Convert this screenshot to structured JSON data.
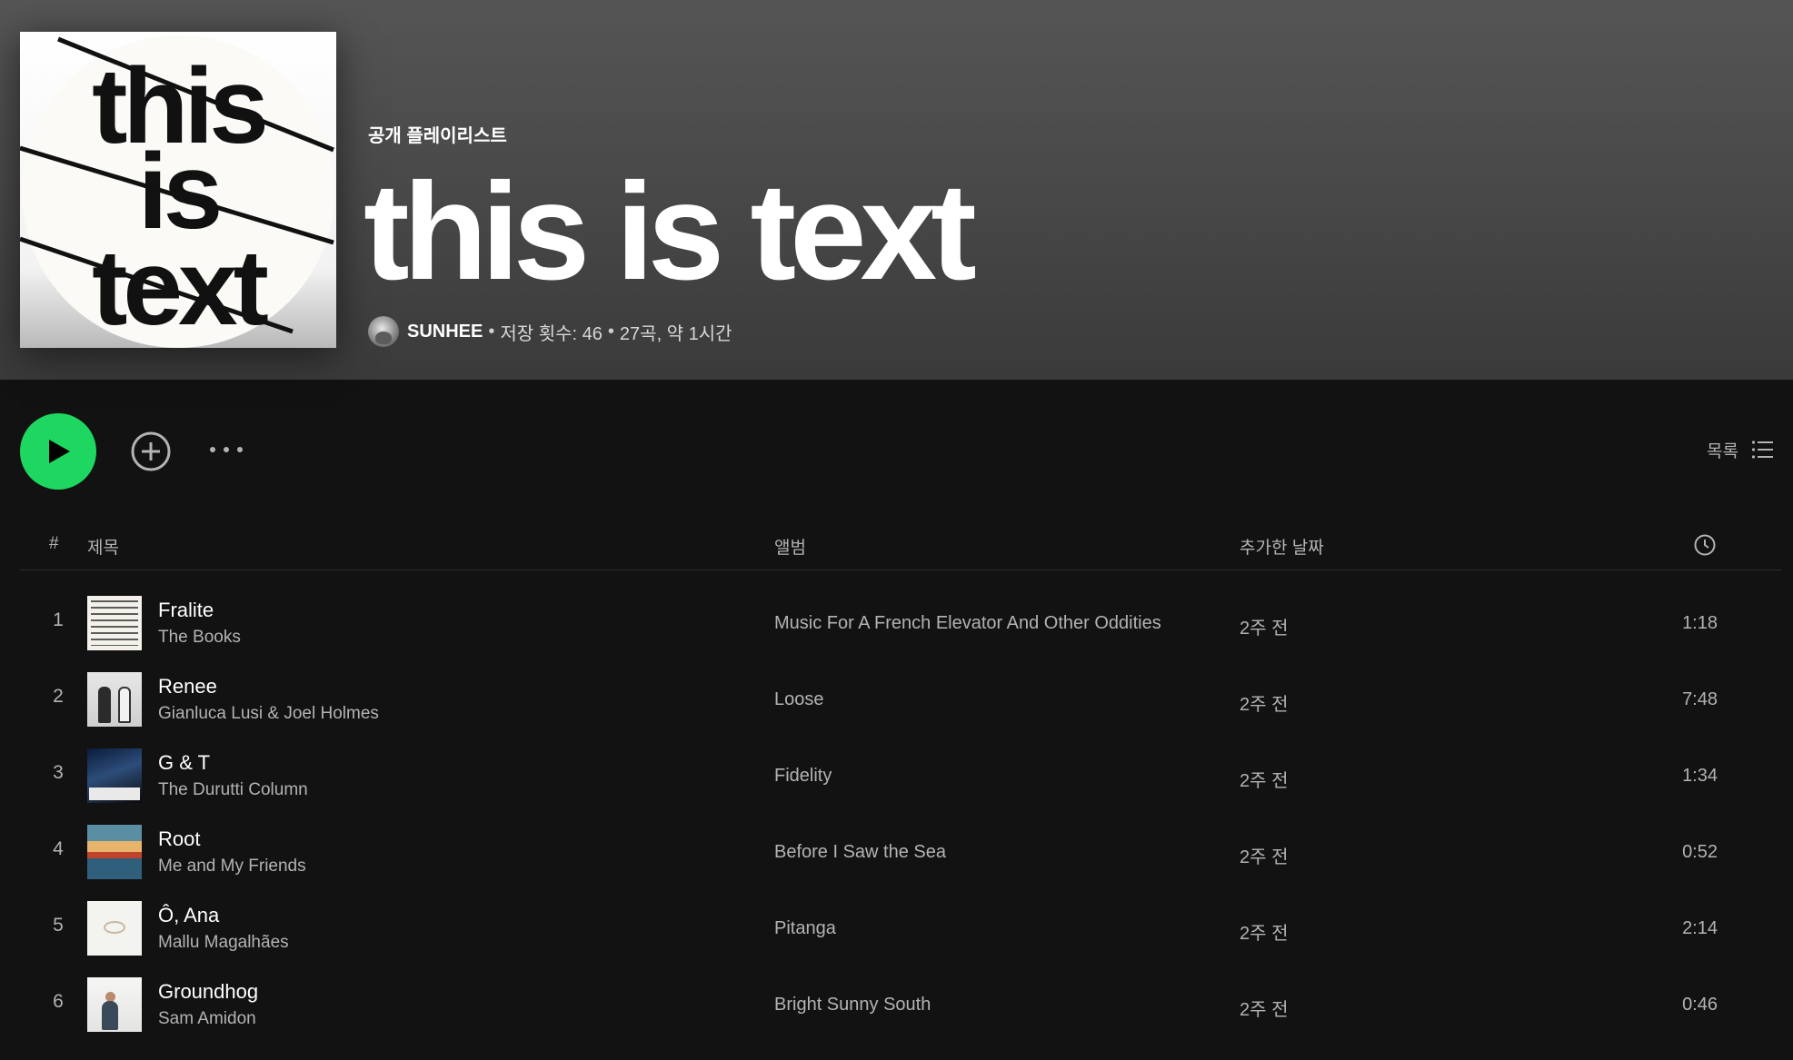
{
  "playlist": {
    "type_label": "공개 플레이리스트",
    "title": "this is text",
    "cover_text": [
      "this",
      "is",
      "text"
    ],
    "owner": "SUNHEE",
    "saves": "저장 횟수: 46",
    "summary": "27곡, 약 1시간"
  },
  "actions": {
    "play": "play",
    "add": "add",
    "more": "more",
    "view_label": "목록"
  },
  "columns": {
    "number": "#",
    "title": "제목",
    "album": "앨범",
    "date_added": "추가한 날짜",
    "duration_icon": "clock-icon"
  },
  "tracks": [
    {
      "num": "1",
      "title": "Fralite",
      "artist": "The Books",
      "album": "Music For A French Elevator And Other Oddities",
      "added": "2주 전",
      "duration": "1:18"
    },
    {
      "num": "2",
      "title": "Renee",
      "artist": "Gianluca Lusi & Joel Holmes",
      "album": "Loose",
      "added": "2주 전",
      "duration": "7:48"
    },
    {
      "num": "3",
      "title": "G & T",
      "artist": "The Durutti Column",
      "album": "Fidelity",
      "added": "2주 전",
      "duration": "1:34"
    },
    {
      "num": "4",
      "title": "Root",
      "artist": "Me and My Friends",
      "album": "Before I Saw the Sea",
      "added": "2주 전",
      "duration": "0:52"
    },
    {
      "num": "5",
      "title": "Ô, Ana",
      "artist": "Mallu Magalhães",
      "album": "Pitanga",
      "added": "2주 전",
      "duration": "2:14"
    },
    {
      "num": "6",
      "title": "Groundhog",
      "artist": "Sam Amidon",
      "album": "Bright Sunny South",
      "added": "2주 전",
      "duration": "0:46"
    }
  ],
  "colors": {
    "accent": "#1ed760",
    "background": "#121212",
    "header": "#4b4b4b",
    "muted_text": "#b3b3b3"
  }
}
